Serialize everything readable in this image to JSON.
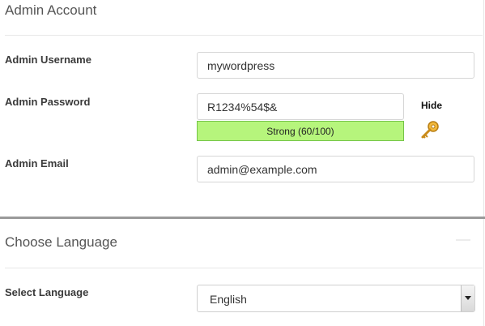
{
  "admin_account": {
    "title": "Admin Account",
    "username": {
      "label": "Admin Username",
      "value": "mywordpress"
    },
    "password": {
      "label": "Admin Password",
      "value": "R1234%54$&",
      "strength_text": "Strong (60/100)",
      "strength_score": 60,
      "toggle_label": "Hide",
      "key_icon": "key-icon"
    },
    "email": {
      "label": "Admin Email",
      "value": "admin@example.com"
    }
  },
  "language": {
    "title": "Choose Language",
    "select": {
      "label": "Select Language",
      "value": "English",
      "arrow_icon": "chevron-down-icon"
    }
  },
  "colors": {
    "strength_fill": "#b6f57c",
    "strength_border": "#74c447",
    "key_gold": "#e3a12a"
  }
}
